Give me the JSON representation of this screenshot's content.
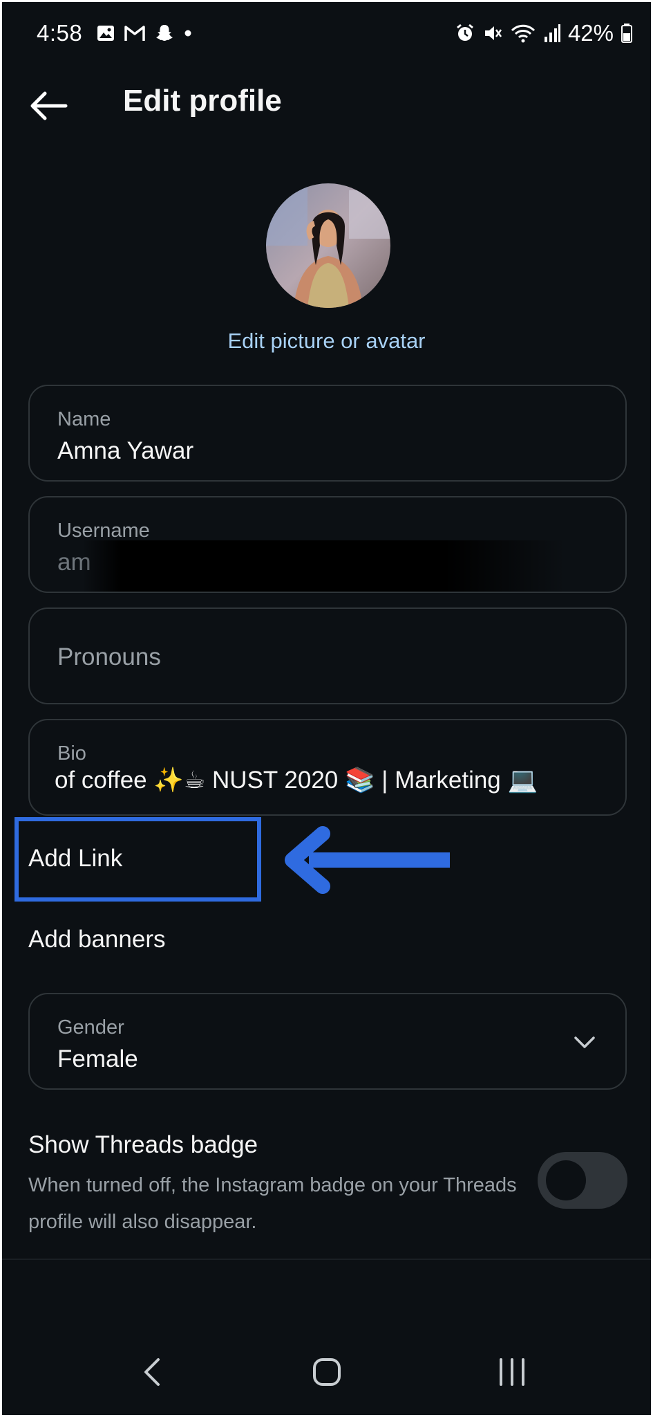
{
  "status_bar": {
    "time": "4:58",
    "battery": "42%",
    "left_icons": [
      "gallery-icon",
      "gmail-icon",
      "snapchat-icon",
      "dot-icon"
    ],
    "right_icons": [
      "alarm-icon",
      "mute-icon",
      "wifi-icon",
      "signal-icon",
      "battery-icon"
    ]
  },
  "header": {
    "title": "Edit profile"
  },
  "avatar": {
    "edit_label": "Edit picture or avatar"
  },
  "fields": {
    "name": {
      "label": "Name",
      "value": "Amna Yawar"
    },
    "username": {
      "label": "Username",
      "value": "am"
    },
    "pronouns": {
      "placeholder": "Pronouns"
    },
    "bio": {
      "label": "Bio",
      "value": "of coffee ✨☕ NUST 2020 📚 | Marketing 💻"
    },
    "gender": {
      "label": "Gender",
      "value": "Female"
    }
  },
  "links": {
    "add_link": "Add Link",
    "add_banners": "Add banners"
  },
  "threads_badge": {
    "title": "Show Threads badge",
    "description": "When turned off, the Instagram badge on your Threads profile will also disappear.",
    "enabled": false
  },
  "colors": {
    "background": "#0c1014",
    "accent_link": "#a8d1f5",
    "highlight": "#2f6be0"
  }
}
